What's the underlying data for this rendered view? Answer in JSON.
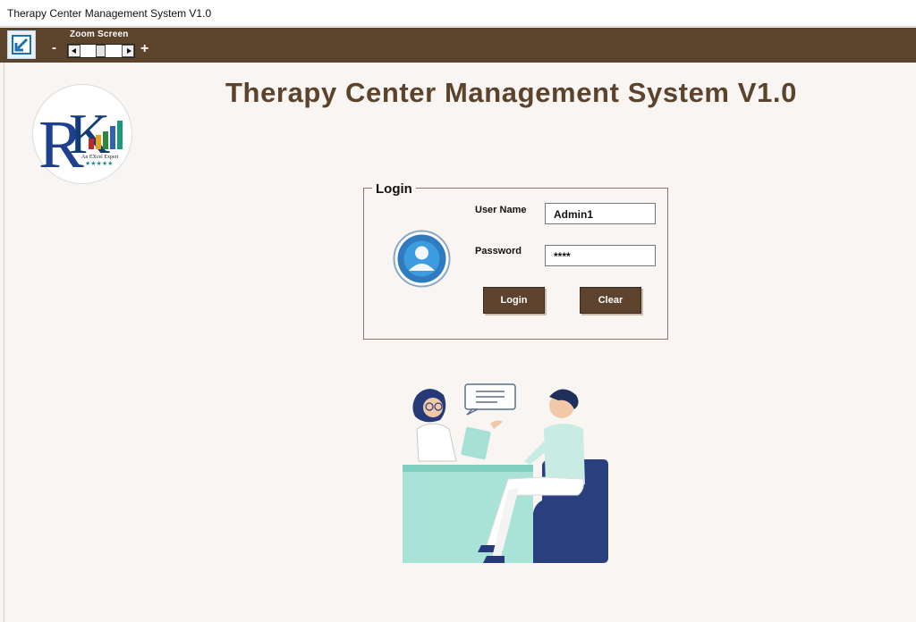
{
  "window": {
    "title": "Therapy Center Management System V1.0"
  },
  "toolbar": {
    "zoom_label": "Zoom Screen",
    "zoom_minus": "-",
    "zoom_plus": "+",
    "exit_icon": "exit-arrow-icon"
  },
  "header": {
    "title": "Therapy Center Management System V1.0"
  },
  "logo": {
    "tagline": "An EXcel Expert",
    "stars": "★★★★★"
  },
  "login": {
    "legend": "Login",
    "username_label": "User Name",
    "username_value": "Admin1",
    "password_label": "Password",
    "password_value": "****",
    "login_button": "Login",
    "clear_button": "Clear",
    "avatar_icon": "user-avatar-icon"
  },
  "colors": {
    "brand_brown": "#5b432c",
    "background": "#f8f5f2",
    "avatar_blue": "#2e7bbf"
  }
}
